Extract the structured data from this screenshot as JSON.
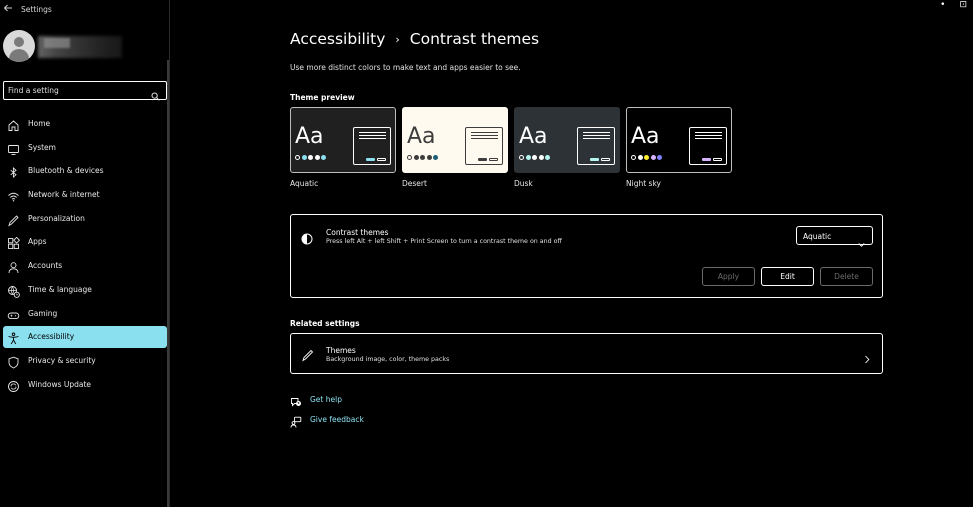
{
  "window": {
    "app_title": "Settings",
    "controls": [
      "•",
      "⊡"
    ]
  },
  "search": {
    "placeholder": "Find a setting"
  },
  "sidebar": {
    "items": [
      {
        "label": "Home",
        "icon": "home-icon"
      },
      {
        "label": "System",
        "icon": "monitor-icon"
      },
      {
        "label": "Bluetooth & devices",
        "icon": "bluetooth-icon"
      },
      {
        "label": "Network & internet",
        "icon": "wifi-icon"
      },
      {
        "label": "Personalization",
        "icon": "pen-icon"
      },
      {
        "label": "Apps",
        "icon": "apps-icon"
      },
      {
        "label": "Accounts",
        "icon": "person-icon"
      },
      {
        "label": "Time & language",
        "icon": "globe-clock-icon"
      },
      {
        "label": "Gaming",
        "icon": "gamepad-icon"
      },
      {
        "label": "Accessibility",
        "icon": "accessibility-icon",
        "active": true
      },
      {
        "label": "Privacy & security",
        "icon": "shield-icon"
      },
      {
        "label": "Windows Update",
        "icon": "update-icon"
      }
    ]
  },
  "main": {
    "breadcrumb_parent": "Accessibility",
    "breadcrumb_sep": "›",
    "breadcrumb_current": "Contrast themes",
    "subtitle": "Use more distinct colors to make text and apps easier to see.",
    "theme_preview_label": "Theme preview",
    "themes": [
      {
        "name": "Aquatic",
        "sample": "Aa",
        "bg": "#202020",
        "fg": "#ffffff",
        "dots": [
          "#202020",
          "#8be0f0",
          "#ffffff",
          "#ffffff",
          "#8be0f0"
        ],
        "win_bg": "#202020",
        "win_border": "#ffffff",
        "line": "#ffffff",
        "btn1": "#8be0f0",
        "btn2_border": "#ffffff"
      },
      {
        "name": "Desert",
        "sample": "Aa",
        "bg": "#fffaef",
        "fg": "#3d3d3d",
        "dots": [
          "#fffaef",
          "#3d3d3d",
          "#3d3d3d",
          "#3d3d3d",
          "#1c5e75"
        ],
        "win_bg": "#fffaef",
        "win_border": "#3d3d3d",
        "line": "#3d3d3d",
        "btn1": "#3d3d3d",
        "btn2_border": "#3d3d3d"
      },
      {
        "name": "Dusk",
        "sample": "Aa",
        "bg": "#2d3236",
        "fg": "#ffffff",
        "dots": [
          "#2d3236",
          "#b6f6f0",
          "#ffffff",
          "#ffffff",
          "#b6f6f0"
        ],
        "win_bg": "#2d3236",
        "win_border": "#ffffff",
        "line": "#ffffff",
        "btn1": "#b6f6f0",
        "btn2_border": "#ffffff"
      },
      {
        "name": "Night sky",
        "sample": "Aa",
        "bg": "#000000",
        "fg": "#ffffff",
        "dots": [
          "#000000",
          "#ffffff",
          "#ffee32",
          "#d6b4fd",
          "#8080ff"
        ],
        "win_bg": "#000000",
        "win_border": "#ffffff",
        "line": "#ffffff",
        "btn1": "#d6b4fd",
        "btn2_border": "#ffffff"
      }
    ],
    "contrast": {
      "title": "Contrast themes",
      "desc": "Press left Alt + left Shift + Print Screen to turn a contrast theme on and off",
      "selected": "Aquatic",
      "apply": "Apply",
      "edit": "Edit",
      "delete": "Delete"
    },
    "related_label": "Related settings",
    "related": {
      "title": "Themes",
      "desc": "Background image, color, theme packs"
    },
    "get_help": "Get help",
    "give_feedback": "Give feedback"
  },
  "colors": {
    "accent": "#8be0f0",
    "background": "#000000",
    "border": "#ffffff",
    "disabled": "#6a6a6a"
  }
}
